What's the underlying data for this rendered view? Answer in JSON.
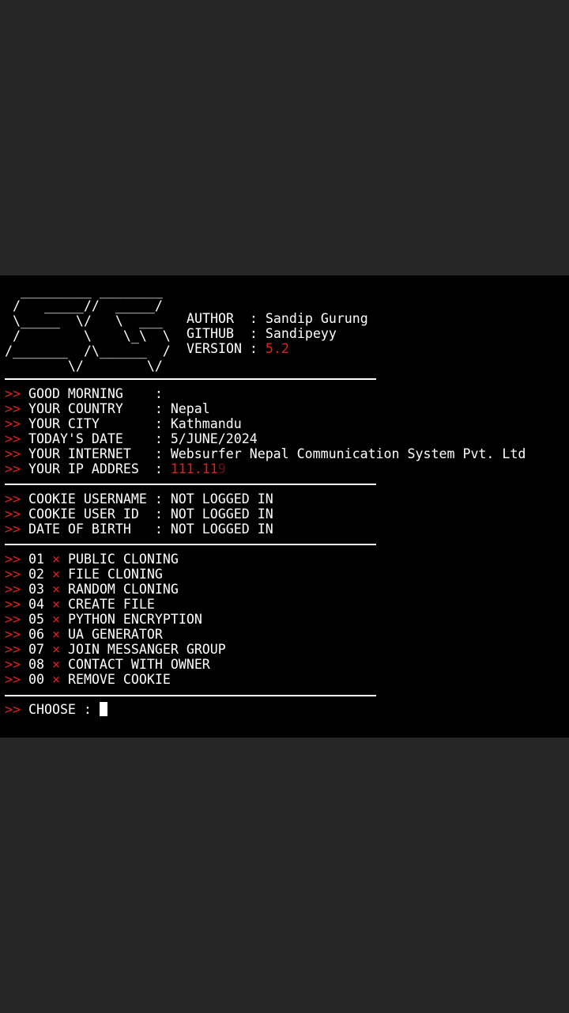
{
  "colors": {
    "page_bg": "#262626",
    "terminal_bg": "#000000",
    "accent_red": "#e02020",
    "text": "#ffffff"
  },
  "logo": [
    "  _________ ________",
    " /   _____//  _____/",
    " \\_____  \\/   \\  ___",
    " /        \\    \\_\\  \\",
    "/_______  /\\______  /",
    "        \\/        \\/"
  ],
  "meta": {
    "author": "AUTHOR  : Sandip Gurung",
    "github": "GITHUB  : Sandipeyy",
    "version_label": "VERSION : ",
    "version_value": "5.2"
  },
  "prompt_symbol": ">>",
  "menu_marker": "×",
  "info": [
    {
      "label": "GOOD MORNING    : ",
      "value": ""
    },
    {
      "label": "YOUR COUNTRY    : ",
      "value": "Nepal"
    },
    {
      "label": "YOUR CITY       : ",
      "value": "Kathmandu"
    },
    {
      "label": "TODAY'S DATE    : ",
      "value": "5/JUNE/2024"
    },
    {
      "label": "YOUR INTERNET   : ",
      "value": "Websurfer Nepal Communication System Pvt. Ltd"
    },
    {
      "label": "YOUR IP ADDRES  : ",
      "value": "111.11",
      "value_tail": "9"
    }
  ],
  "cookie": [
    {
      "label": "COOKIE USERNAME : ",
      "value": "NOT LOGGED IN"
    },
    {
      "label": "COOKIE USER ID  : ",
      "value": "NOT LOGGED IN"
    },
    {
      "label": "DATE OF BIRTH   : ",
      "value": "NOT LOGGED IN"
    }
  ],
  "menu": [
    {
      "num": "01",
      "label": "PUBLIC CLONING"
    },
    {
      "num": "02",
      "label": "FILE CLONING"
    },
    {
      "num": "03",
      "label": "RANDOM CLONING"
    },
    {
      "num": "04",
      "label": "CREATE FILE"
    },
    {
      "num": "05",
      "label": "PYTHON ENCRYPTION"
    },
    {
      "num": "06",
      "label": "UA GENERATOR"
    },
    {
      "num": "07",
      "label": "JOIN MESSANGER GROUP"
    },
    {
      "num": "08",
      "label": "CONTACT WITH OWNER"
    },
    {
      "num": "00",
      "label": "REMOVE COOKIE"
    }
  ],
  "choose_label": "CHOOSE : "
}
